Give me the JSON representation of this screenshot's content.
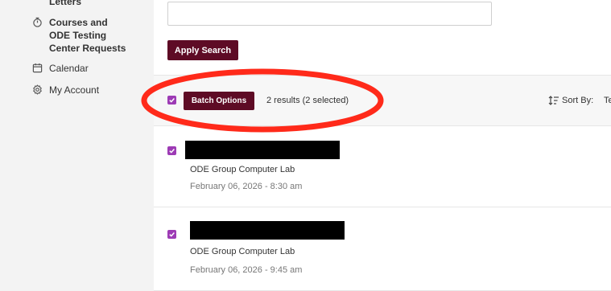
{
  "sidebar": {
    "items": [
      {
        "label": "Letters",
        "icon": "letters-icon"
      },
      {
        "label": "Courses and ODE Testing Center Requests",
        "icon": "stopwatch-icon"
      },
      {
        "label": "Calendar",
        "icon": "calendar-icon"
      },
      {
        "label": "My Account",
        "icon": "gear-icon"
      }
    ]
  },
  "search": {
    "value": "",
    "apply_label": "Apply Search"
  },
  "batch": {
    "checked": true,
    "button_label": "Batch Options",
    "result_count": "2 results (2 selected)",
    "sort_label": "Sort By:",
    "sort_value": "Te"
  },
  "results": [
    {
      "checked": true,
      "location": "ODE Group Computer Lab",
      "datetime": "February 06, 2026 - 8:30 am"
    },
    {
      "checked": true,
      "location": "ODE Group Computer Lab",
      "datetime": "February 06, 2026 - 9:45 am"
    }
  ],
  "colors": {
    "button_bg": "#5e0b25",
    "checkbox": "#9d3bb5",
    "annotation": "#ff2a1a"
  }
}
